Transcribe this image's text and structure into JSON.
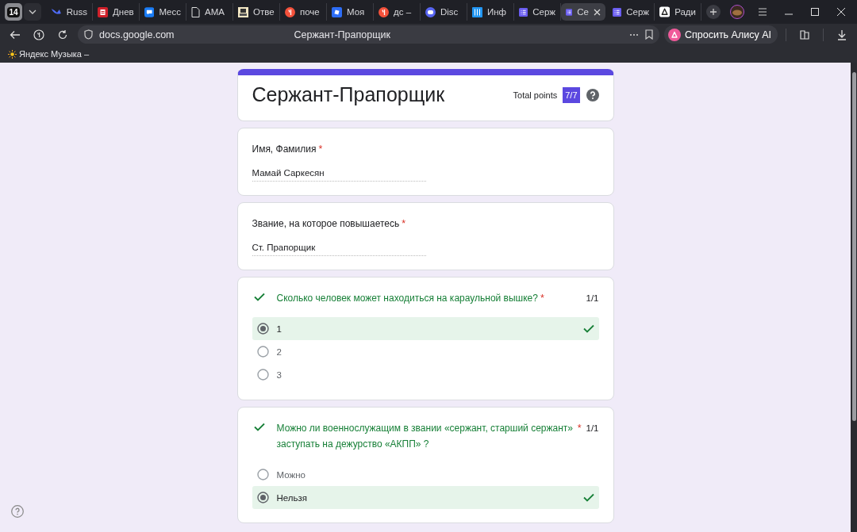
{
  "tab_counter": "14",
  "tabs": [
    {
      "label": "Russ",
      "kind": "bird",
      "selected": false
    },
    {
      "label": "Днев",
      "kind": "red-doc",
      "selected": false
    },
    {
      "label": "Месс",
      "kind": "chat",
      "selected": false
    },
    {
      "label": "АМА",
      "kind": "file",
      "selected": false
    },
    {
      "label": "Отве",
      "kind": "note",
      "selected": false
    },
    {
      "label": "поче",
      "kind": "ya",
      "selected": false
    },
    {
      "label": "Моя",
      "kind": "square",
      "selected": false
    },
    {
      "label": "дс –",
      "kind": "ya",
      "selected": false
    },
    {
      "label": "Disc",
      "kind": "discord",
      "selected": false
    },
    {
      "label": "Инф",
      "kind": "grid",
      "selected": false
    },
    {
      "label": "Серж",
      "kind": "form",
      "selected": false
    },
    {
      "label": "Се",
      "kind": "form",
      "selected": true
    },
    {
      "label": "Серж",
      "kind": "form",
      "selected": false
    },
    {
      "label": "Ради",
      "kind": "alice",
      "selected": false
    }
  ],
  "address_bar": {
    "url": "docs.google.com",
    "page_title": "Сержант-Прапорщик",
    "alice_button": "Спросить Алису AI"
  },
  "bookmarks": [
    {
      "label": "Яндекс Музыка –"
    }
  ],
  "form": {
    "title": "Сержант-Прапорщик",
    "total_points_label": "Total points",
    "score": "7/7",
    "questions": [
      {
        "kind": "text",
        "label": "Имя, Фамилия",
        "required_mark": "*",
        "answer": "Мамай Саркесян"
      },
      {
        "kind": "text",
        "label": "Звание, на которое повышаетесь",
        "required_mark": "*",
        "answer": "Ст. Прапорщик"
      },
      {
        "kind": "choice",
        "label": "Сколько человек может находиться на караульной вышке?",
        "required_mark": "*",
        "correct": true,
        "points": "1/1",
        "options": [
          {
            "label": "1",
            "selected": true
          },
          {
            "label": "2",
            "selected": false
          },
          {
            "label": "3",
            "selected": false
          }
        ]
      },
      {
        "kind": "choice",
        "label": "Можно ли военнослужащим в звании «сержант, старший сержант» заступать на дежурство «АКПП» ?",
        "required_mark": "*",
        "correct": true,
        "points": "1/1",
        "options": [
          {
            "label": "Можно",
            "selected": false
          },
          {
            "label": "Нельзя",
            "selected": true
          }
        ]
      }
    ]
  }
}
